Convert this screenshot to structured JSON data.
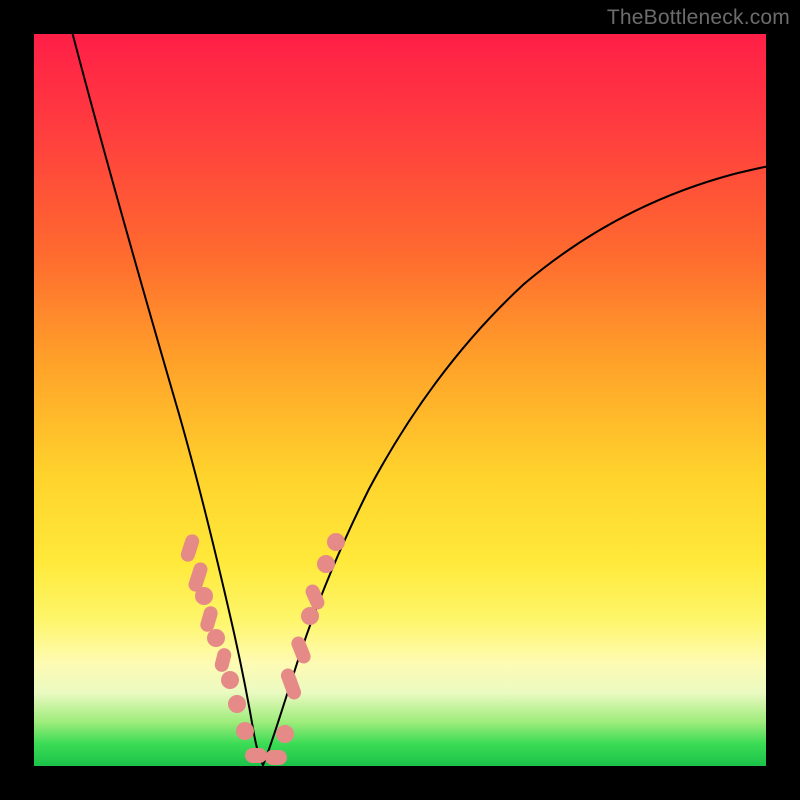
{
  "watermark": "TheBottleneck.com",
  "colors": {
    "frame": "#000000",
    "gradient_top": "#ff1f47",
    "gradient_bottom": "#1bc24a",
    "curve": "#000000",
    "marker": "#e58a87"
  },
  "chart_data": {
    "type": "line",
    "title": "",
    "xlabel": "",
    "ylabel": "",
    "xlim": [
      0,
      100
    ],
    "ylim": [
      0,
      100
    ],
    "grid": false,
    "legend": false,
    "annotations": [
      "TheBottleneck.com"
    ],
    "series": [
      {
        "name": "left-curve",
        "x": [
          5,
          8,
          11,
          14,
          16,
          18,
          20,
          22,
          24,
          25,
          26,
          27,
          28,
          29,
          30
        ],
        "y": [
          100,
          83,
          68,
          55,
          47,
          40,
          33,
          26,
          19,
          15,
          11,
          8,
          5,
          3,
          1
        ]
      },
      {
        "name": "right-curve",
        "x": [
          30,
          31,
          33,
          35,
          38,
          42,
          47,
          53,
          60,
          68,
          77,
          86,
          95,
          100
        ],
        "y": [
          1,
          4,
          11,
          19,
          28,
          38,
          48,
          56,
          63,
          69,
          74,
          78,
          81,
          83
        ]
      }
    ],
    "markers": {
      "name": "highlight-points",
      "note": "Salmon dots/pills clustered near the valley of the V-shape",
      "points": [
        {
          "x": 21,
          "y": 30
        },
        {
          "x": 22,
          "y": 26
        },
        {
          "x": 22.5,
          "y": 23
        },
        {
          "x": 23,
          "y": 20
        },
        {
          "x": 24,
          "y": 17
        },
        {
          "x": 25,
          "y": 13
        },
        {
          "x": 26,
          "y": 10
        },
        {
          "x": 27,
          "y": 7
        },
        {
          "x": 28,
          "y": 4
        },
        {
          "x": 29,
          "y": 2
        },
        {
          "x": 30,
          "y": 1
        },
        {
          "x": 31,
          "y": 1
        },
        {
          "x": 32,
          "y": 2
        },
        {
          "x": 34,
          "y": 12
        },
        {
          "x": 35,
          "y": 17
        },
        {
          "x": 36,
          "y": 20
        },
        {
          "x": 37,
          "y": 23
        },
        {
          "x": 39,
          "y": 30
        }
      ]
    }
  }
}
